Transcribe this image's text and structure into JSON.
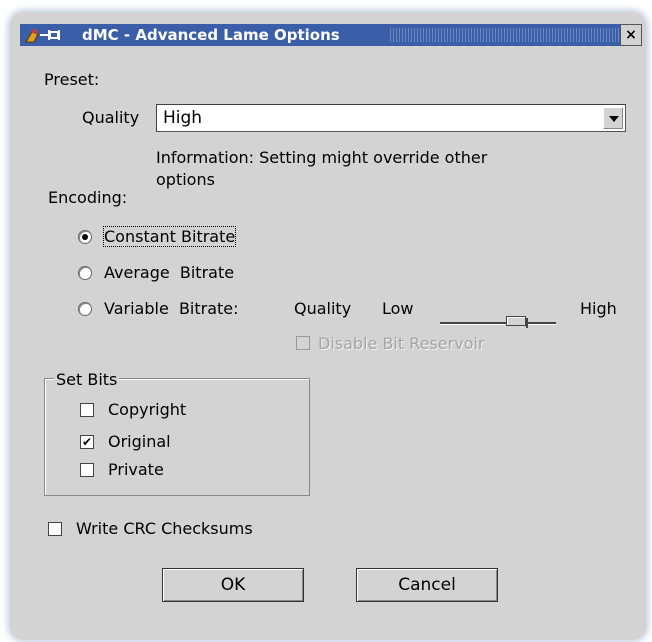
{
  "window": {
    "title": "dMC - Advanced Lame Options",
    "close_label": "×"
  },
  "preset": {
    "label": "Preset:",
    "quality_label": "Quality",
    "quality_value": "High",
    "info_line1": "Information: Setting might override other",
    "info_line2": "options"
  },
  "encoding": {
    "label": "Encoding:",
    "options": [
      {
        "label": "Constant Bitrate",
        "selected": true
      },
      {
        "label": "Average  Bitrate",
        "selected": false
      },
      {
        "label": "Variable  Bitrate:",
        "selected": false
      }
    ],
    "vbr_quality_label": "Quality",
    "vbr_low_label": "Low",
    "vbr_high_label": "High",
    "disable_reservoir_label": "Disable Bit Reservoir"
  },
  "set_bits": {
    "label": "Set Bits",
    "items": [
      {
        "label": "Copyright",
        "checked": false
      },
      {
        "label": "Original",
        "checked": true
      },
      {
        "label": "Private",
        "checked": false
      }
    ]
  },
  "crc": {
    "label": "Write CRC Checksums",
    "checked": false
  },
  "buttons": {
    "ok": "OK",
    "cancel": "Cancel"
  },
  "check_mark": "✔"
}
